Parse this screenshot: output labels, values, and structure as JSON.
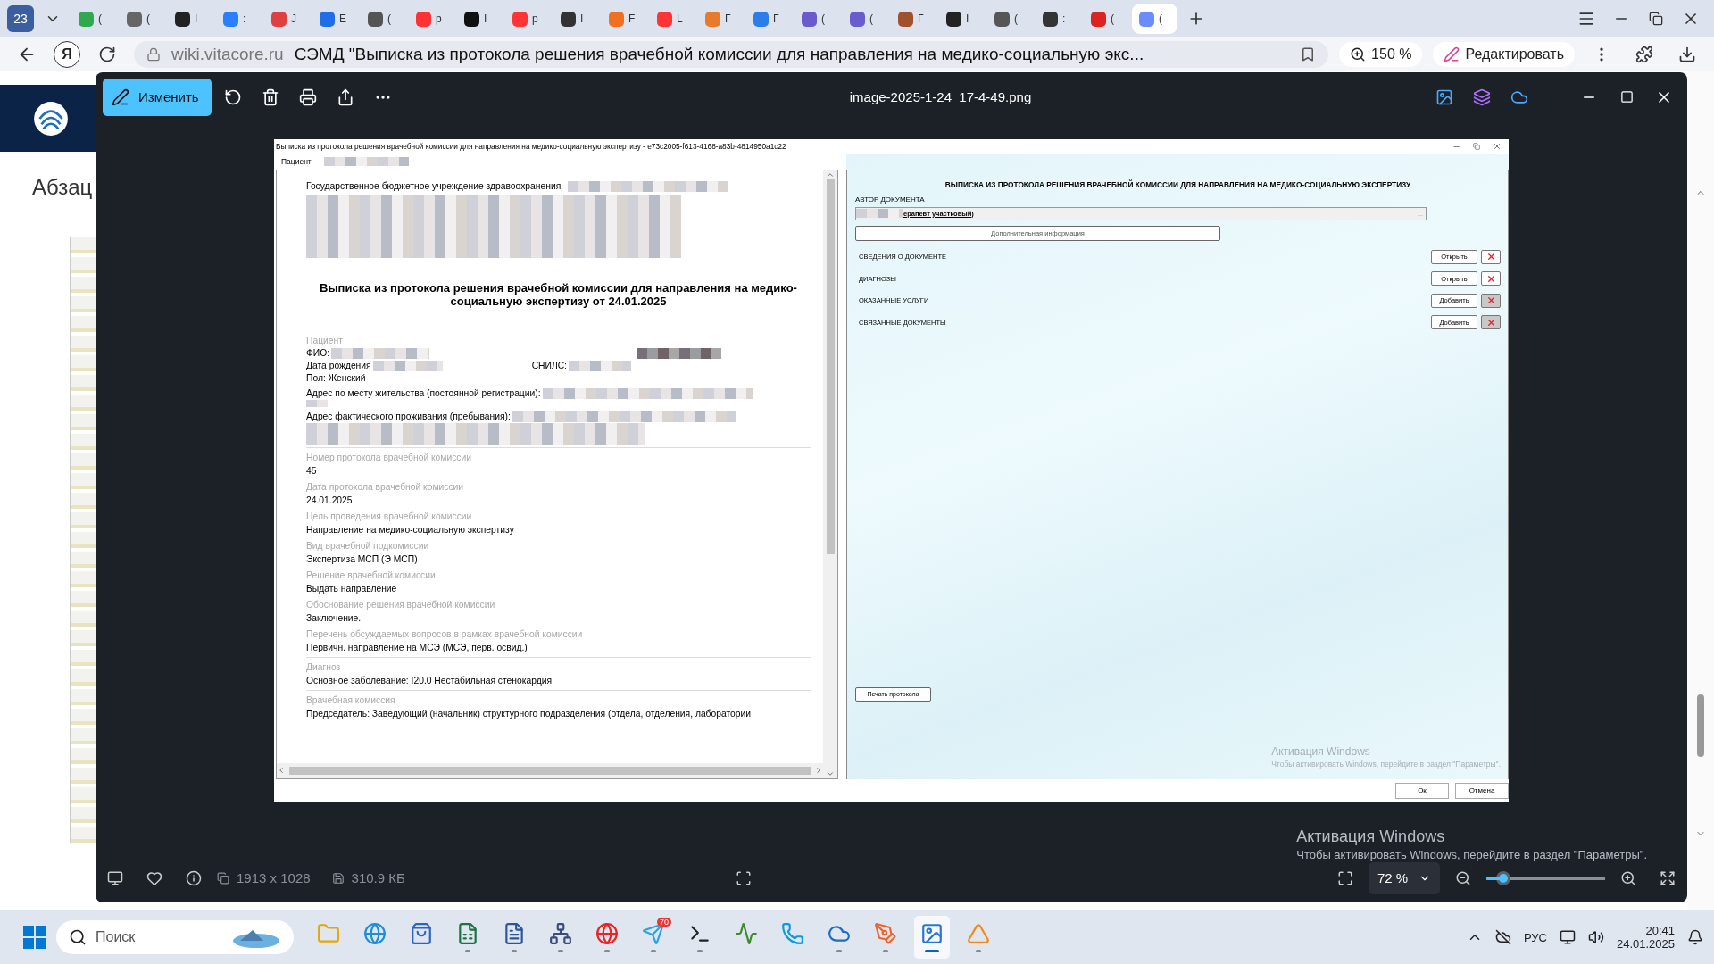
{
  "browser": {
    "tab_count": "23",
    "tabs": [
      {
        "title": "(",
        "color": "#2fa84f",
        "selected": false
      },
      {
        "title": "(",
        "color": "#666666",
        "selected": false
      },
      {
        "title": "I",
        "color": "#222222",
        "selected": false
      },
      {
        "title": ":",
        "color": "#2a7fff",
        "selected": false
      },
      {
        "title": "J",
        "color": "#e04040",
        "selected": false
      },
      {
        "title": "E",
        "color": "#1e6ee8",
        "selected": false
      },
      {
        "title": "(",
        "color": "#555555",
        "selected": false
      },
      {
        "title": "р",
        "color": "#ff3333",
        "selected": false
      },
      {
        "title": "I",
        "color": "#111111",
        "selected": false
      },
      {
        "title": "р",
        "color": "#ff3434",
        "selected": false
      },
      {
        "title": "I",
        "color": "#333333",
        "selected": false
      },
      {
        "title": "F",
        "color": "#f07020",
        "selected": false
      },
      {
        "title": "L",
        "color": "#ff3535",
        "selected": false
      },
      {
        "title": "Г",
        "color": "#e87a2a",
        "selected": false
      },
      {
        "title": "Г",
        "color": "#2b7de9",
        "selected": false
      },
      {
        "title": "(",
        "color": "#6a5acd",
        "selected": false
      },
      {
        "title": "(",
        "color": "#6a5bce",
        "selected": false
      },
      {
        "title": "Г",
        "color": "#a0522d",
        "selected": false
      },
      {
        "title": "I",
        "color": "#232323",
        "selected": false
      },
      {
        "title": "(",
        "color": "#565656",
        "selected": false
      },
      {
        "title": ":",
        "color": "#343434",
        "selected": false
      },
      {
        "title": "(",
        "color": "#dd2222",
        "selected": false
      },
      {
        "title": "(",
        "color": "#6b8cff",
        "selected": true
      }
    ],
    "home_label": "Я",
    "address": "wiki.vitacore.ru",
    "page_title": "СЭМД \"Выписка из протокола решения врачебной комиссии для направления на медико-социальную экс...",
    "zoom": "150 %",
    "edit_button": "Редактировать"
  },
  "page": {
    "heading": "Абзац"
  },
  "viewer": {
    "edit_button": "Изменить",
    "file_name": "image-2025-1-24_17-4-49.png",
    "favorite": false,
    "dimensions": "1913 x 1028",
    "file_size": "310.9 КБ",
    "zoom": "72 %",
    "zoom_slider": {
      "level": 0.14
    }
  },
  "dialog": {
    "title": "Выписка из протокола решения врачебной комиссии для направления на медико-социальную экспертизу - e73c2005-f613-4168-a83b-4814950a1c22",
    "tab": "Пациент",
    "document": {
      "organization": "Государственное бюджетное учреждение здравоохранения",
      "heading": "Выписка из протокола решения врачебной комиссии для направления на медико-социальную экспертизу от 24.01.2025",
      "patient_label": "Пациент",
      "fio_label": "ФИО:",
      "birth_label": "Дата рождения",
      "snils_label": "СНИЛС:",
      "sex": "Пол: Женский",
      "registration_address_label": "Адрес по месту жительства (постоянной регистрации):",
      "actual_address_label": "Адрес фактического проживания (пребывания):",
      "section_groups": [
        [
          {
            "label": "Номер протокола врачебной комиссии",
            "value": "45"
          },
          {
            "label": "Дата протокола врачебной комиссии",
            "value": "24.01.2025"
          },
          {
            "label": "Цель проведения врачебной комиссии",
            "value": "Направление на медико-социальную экспертизу"
          },
          {
            "label": "Вид врачебной подкомиссии",
            "value": "Экспертиза МСП (Э МСП)"
          },
          {
            "label": "Решение врачебной комиссии",
            "value": "Выдать направление"
          },
          {
            "label": "Обоснование решения врачебной комиссии",
            "value": "Заключение."
          },
          {
            "label": "Перечень обсуждаемых вопросов в рамках врачебной комиссии",
            "value": "Первичн. направление на МСЭ (МСЭ, перв. освид.)"
          }
        ],
        [
          {
            "label": "Диагноз",
            "value": "Основное заболевание: I20.0 Нестабильная стенокардия"
          }
        ],
        [
          {
            "label": "Врачебная комиссия",
            "value": "Председатель: Заведующий (начальник) структурного подразделения (отдела, отделения, лаборатории"
          }
        ]
      ]
    },
    "form": {
      "heading": "ВЫПИСКА ИЗ ПРОТОКОЛА РЕШЕНИЯ ВРАЧЕБНОЙ КОМИССИИ ДЛЯ НАПРАВЛЕНИЯ НА МЕДИКО-СОЦИАЛЬНУЮ ЭКСПЕРТИЗУ",
      "author_label": "АВТОР ДОКУМЕНТА",
      "author_value": "ерапевт участковый)",
      "browse_button": "...",
      "more_button": "Дополнительная информация",
      "rows": [
        {
          "label": "СВЕДЕНИЯ О ДОКУМЕНТЕ",
          "action": "Открыть",
          "disabled": false
        },
        {
          "label": "ДИАГНОЗЫ",
          "action": "Открыть",
          "disabled": false
        },
        {
          "label": "ОКАЗАННЫЕ УСЛУГИ",
          "action": "Добавить",
          "disabled": true
        },
        {
          "label": "СВЯЗАННЫЕ ДОКУМЕНТЫ",
          "action": "Добавить",
          "disabled": true
        }
      ],
      "print_button": "Печать протокола"
    },
    "buttons": [
      "Ок",
      "Отмена"
    ]
  },
  "image_activation_notice": {
    "title": "Активация Windows",
    "text": "Чтобы активировать Windows, перейдите в раздел \"Параметры\"."
  },
  "activation_notice": {
    "title": "Активация Windows",
    "text": "Чтобы активировать Windows, перейдите в раздел \"Параметры\"."
  },
  "taskbar": {
    "search_placeholder": "Поиск",
    "apps": [
      {
        "kind": "folder",
        "running": false,
        "selected": false
      },
      {
        "kind": "edge",
        "running": false,
        "selected": false
      },
      {
        "kind": "store",
        "running": false,
        "selected": false
      },
      {
        "kind": "excel",
        "running": true,
        "selected": false
      },
      {
        "kind": "word",
        "running": true,
        "selected": false
      },
      {
        "kind": "network",
        "running": true,
        "selected": false
      },
      {
        "kind": "yandex",
        "running": true,
        "selected": false
      },
      {
        "kind": "telegram",
        "running": true,
        "selected": false,
        "badge": "70"
      },
      {
        "kind": "terminal",
        "running": true,
        "selected": false
      },
      {
        "kind": "chart",
        "running": false,
        "selected": false
      },
      {
        "kind": "skype",
        "running": false,
        "selected": false
      },
      {
        "kind": "cloud",
        "running": true,
        "selected": false
      },
      {
        "kind": "pen",
        "running": true,
        "selected": false
      },
      {
        "kind": "photos",
        "running": true,
        "selected": true
      },
      {
        "kind": "fan",
        "running": true,
        "selected": false
      }
    ],
    "language": "РУС",
    "time": "20:41",
    "date": "24.01.2025"
  }
}
